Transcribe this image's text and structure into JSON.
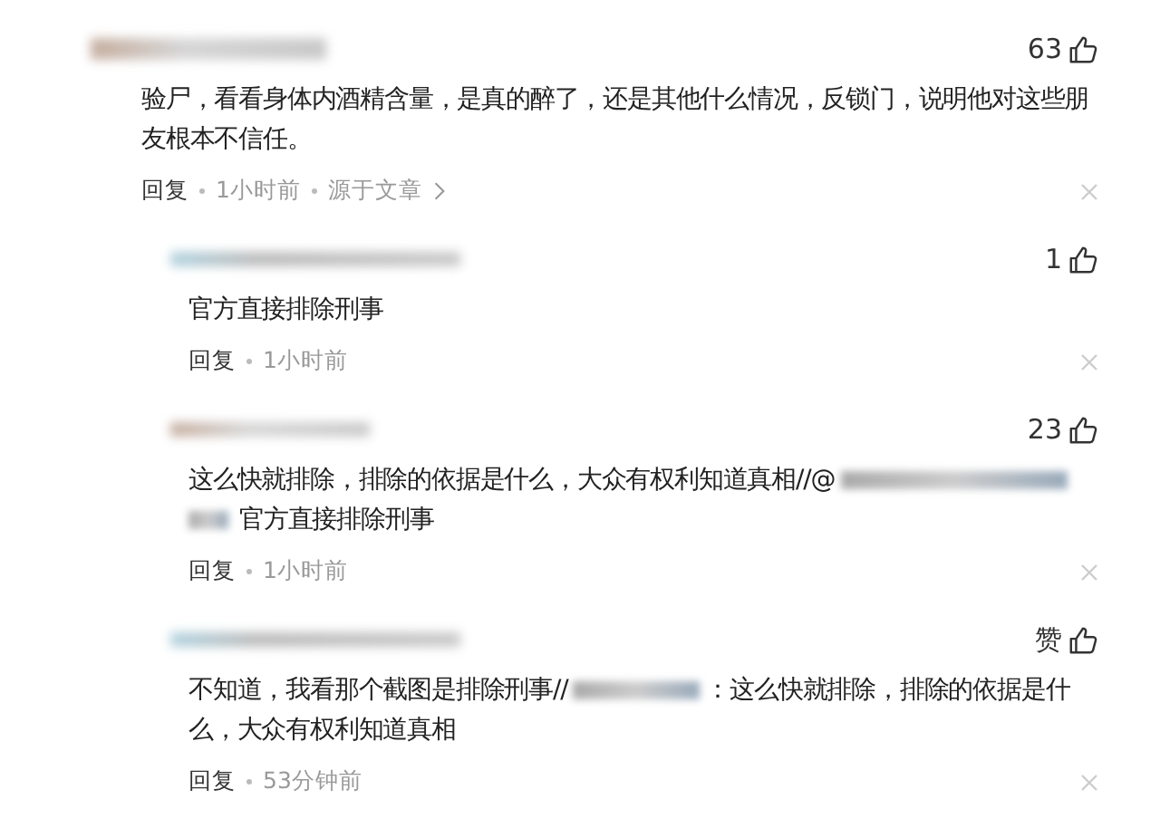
{
  "comments": [
    {
      "likes": "63",
      "lines": [
        [
          {
            "kind": "text",
            "text": "验尸，看看身体内酒精含量，是真的醉了，还是其他什么情况，反锁门，说明他对这些朋"
          }
        ],
        [
          {
            "kind": "text",
            "text": "友根本不信任。"
          }
        ]
      ],
      "meta": [
        {
          "kind": "reply",
          "text": "回复"
        },
        {
          "kind": "time",
          "text": "1小时前"
        },
        {
          "kind": "source",
          "text": "源于文章"
        }
      ],
      "children": [
        {
          "likes": "1",
          "lines": [
            [
              {
                "kind": "text",
                "text": "官方直接排除刑事"
              }
            ]
          ],
          "meta": [
            {
              "kind": "reply",
              "text": "回复"
            },
            {
              "kind": "time",
              "text": "1小时前"
            }
          ]
        },
        {
          "likes": "23",
          "lines": [
            [
              {
                "kind": "text",
                "text": "这么快就排除，排除的依据是什么，大众有权利知道真相//@"
              },
              {
                "kind": "redacted"
              }
            ],
            [
              {
                "kind": "redacted"
              },
              {
                "kind": "text",
                "text": "官方直接排除刑事"
              }
            ]
          ],
          "meta": [
            {
              "kind": "reply",
              "text": "回复"
            },
            {
              "kind": "time",
              "text": "1小时前"
            }
          ]
        },
        {
          "likes": "赞",
          "lines": [
            [
              {
                "kind": "text",
                "text": "不知道，我看那个截图是排除刑事//"
              },
              {
                "kind": "redacted"
              },
              {
                "kind": "text",
                "text": "：这么快就排除，排除的依据是什"
              }
            ],
            [
              {
                "kind": "text",
                "text": "么，大众有权利知道真相"
              }
            ]
          ],
          "meta": [
            {
              "kind": "reply",
              "text": "回复"
            },
            {
              "kind": "time",
              "text": "53分钟前"
            }
          ]
        }
      ]
    }
  ]
}
